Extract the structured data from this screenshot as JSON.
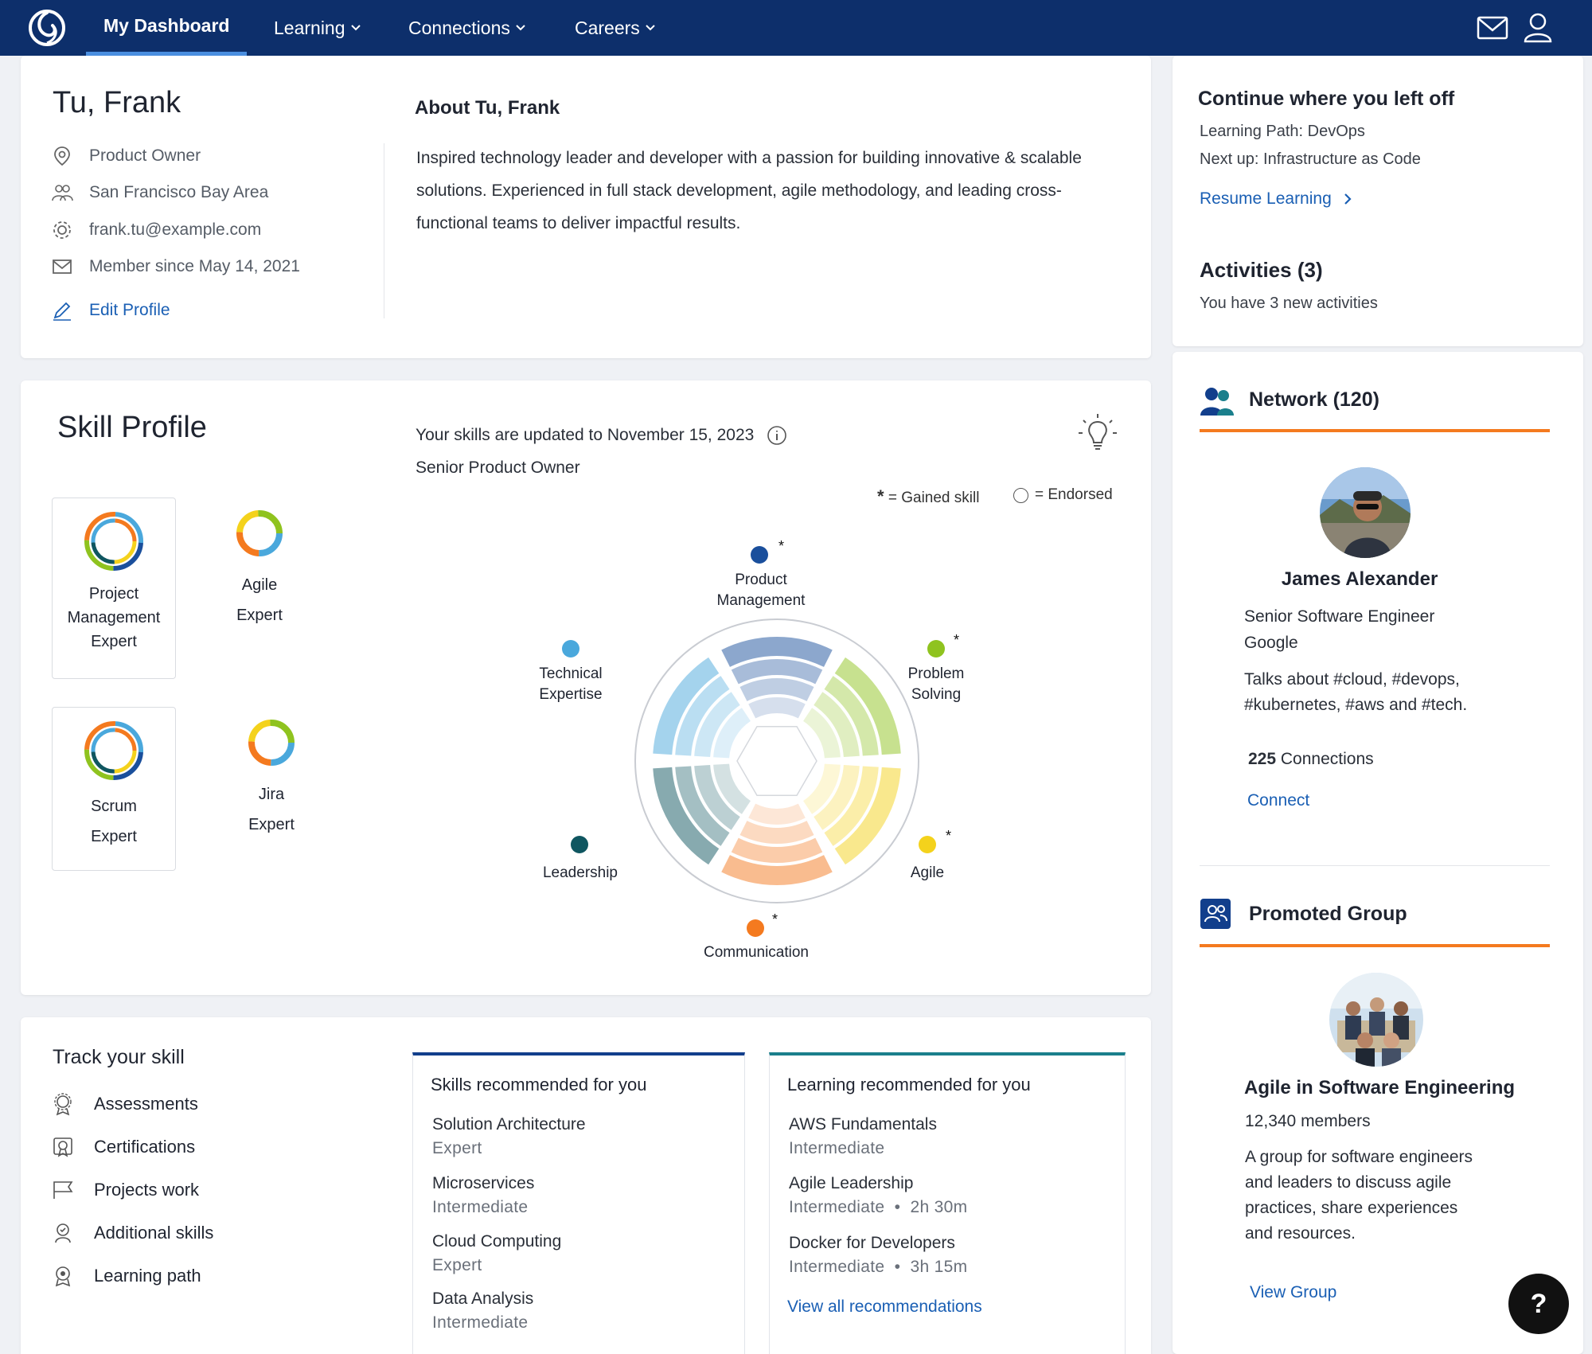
{
  "nav": {
    "items": [
      "My Dashboard",
      "Learning",
      "Connections",
      "Careers"
    ],
    "active_index": 0
  },
  "profile": {
    "name": "Tu, Frank",
    "role": "Product Owner",
    "location": "San Francisco Bay Area",
    "email": "frank.tu@example.com",
    "member_since": "Member since May 14, 2021",
    "edit_label": "Edit Profile",
    "about_title": "About Tu, Frank",
    "about_text": "Inspired technology leader and developer with a passion for building innovative & scalable solutions. Experienced in full stack development, agile methodology, and leading cross-functional teams to deliver impactful results."
  },
  "continue": {
    "title": "Continue where you left off",
    "path": "Learning Path: DevOps",
    "next": "Next up: Infrastructure as Code",
    "resume_label": "Resume Learning",
    "activities_title": "Activities (3)",
    "activities_text": "You have 3 new activities"
  },
  "skill_profile": {
    "title": "Skill Profile",
    "updated": "Your skills are updated to November 15, 2023",
    "level": "Senior Product Owner",
    "legend_gained": "= Gained skill",
    "legend_endorsed": "= Endorsed",
    "badges": [
      {
        "line1": "Project",
        "line2": "Management",
        "line3": "Expert"
      },
      {
        "line1": "Agile",
        "line2": "Expert"
      },
      {
        "line1": "Scrum",
        "line2": "Expert"
      },
      {
        "line1": "Jira",
        "line2": "Expert"
      }
    ],
    "segments": [
      {
        "line1": "Product",
        "line2": "Management",
        "color": "#1a4f9c",
        "gained": true
      },
      {
        "line1": "Problem",
        "line2": "Solving",
        "color": "#8fc31f",
        "gained": true
      },
      {
        "line1": "Agile",
        "line2": "",
        "color": "#f4d21c",
        "gained": true
      },
      {
        "line1": "Communication",
        "line2": "",
        "color": "#f47a1f",
        "gained": true
      },
      {
        "line1": "Leadership",
        "line2": "",
        "color": "#0f5660",
        "gained": false
      },
      {
        "line1": "Technical",
        "line2": "Expertise",
        "color": "#4aa8dc",
        "gained": false
      }
    ],
    "star": "*"
  },
  "track": {
    "title": "Track your skill",
    "items": [
      "Assessments",
      "Certifications",
      "Projects work",
      "Additional skills",
      "Learning path"
    ]
  },
  "skills_reco": {
    "title": "Skills recommended for you",
    "items": [
      {
        "name": "Solution Architecture",
        "level": "Expert"
      },
      {
        "name": "Microservices",
        "level": "Intermediate"
      },
      {
        "name": "Cloud Computing",
        "level": "Expert"
      },
      {
        "name": "Data Analysis",
        "level": "Intermediate"
      }
    ]
  },
  "learning_reco": {
    "title": "Learning recommended for you",
    "items": [
      {
        "name": "AWS Fundamentals",
        "level": "Intermediate"
      },
      {
        "name": "Agile Leadership",
        "level": "Intermediate  •  2h 30m"
      },
      {
        "name": "Docker for Developers",
        "level": "Intermediate  •  3h 15m"
      }
    ],
    "view_all": "View all recommendations"
  },
  "network": {
    "title": "Network (120)",
    "person_name": "James Alexander",
    "person_title": "Senior Software Engineer",
    "person_company": "Google",
    "talks_line1": "Talks about #cloud, #devops,",
    "talks_line2": "#kubernetes, #aws and #tech.",
    "connections_count": "225",
    "connections_label": "Connections",
    "connect_label": "Connect"
  },
  "group": {
    "title": "Promoted Group",
    "name": "Agile in Software Engineering",
    "members": "12,340 members",
    "desc_line1": "A group for software engineers",
    "desc_line2": "and leaders to discuss agile",
    "desc_line3": "practices, share experiences",
    "desc_line4": "and resources.",
    "view_label": "View Group"
  },
  "help_label": "?",
  "colors": {
    "nav_bg": "#0d2f6b",
    "accent_orange": "#f47a1f",
    "link": "#1a5fb4"
  }
}
